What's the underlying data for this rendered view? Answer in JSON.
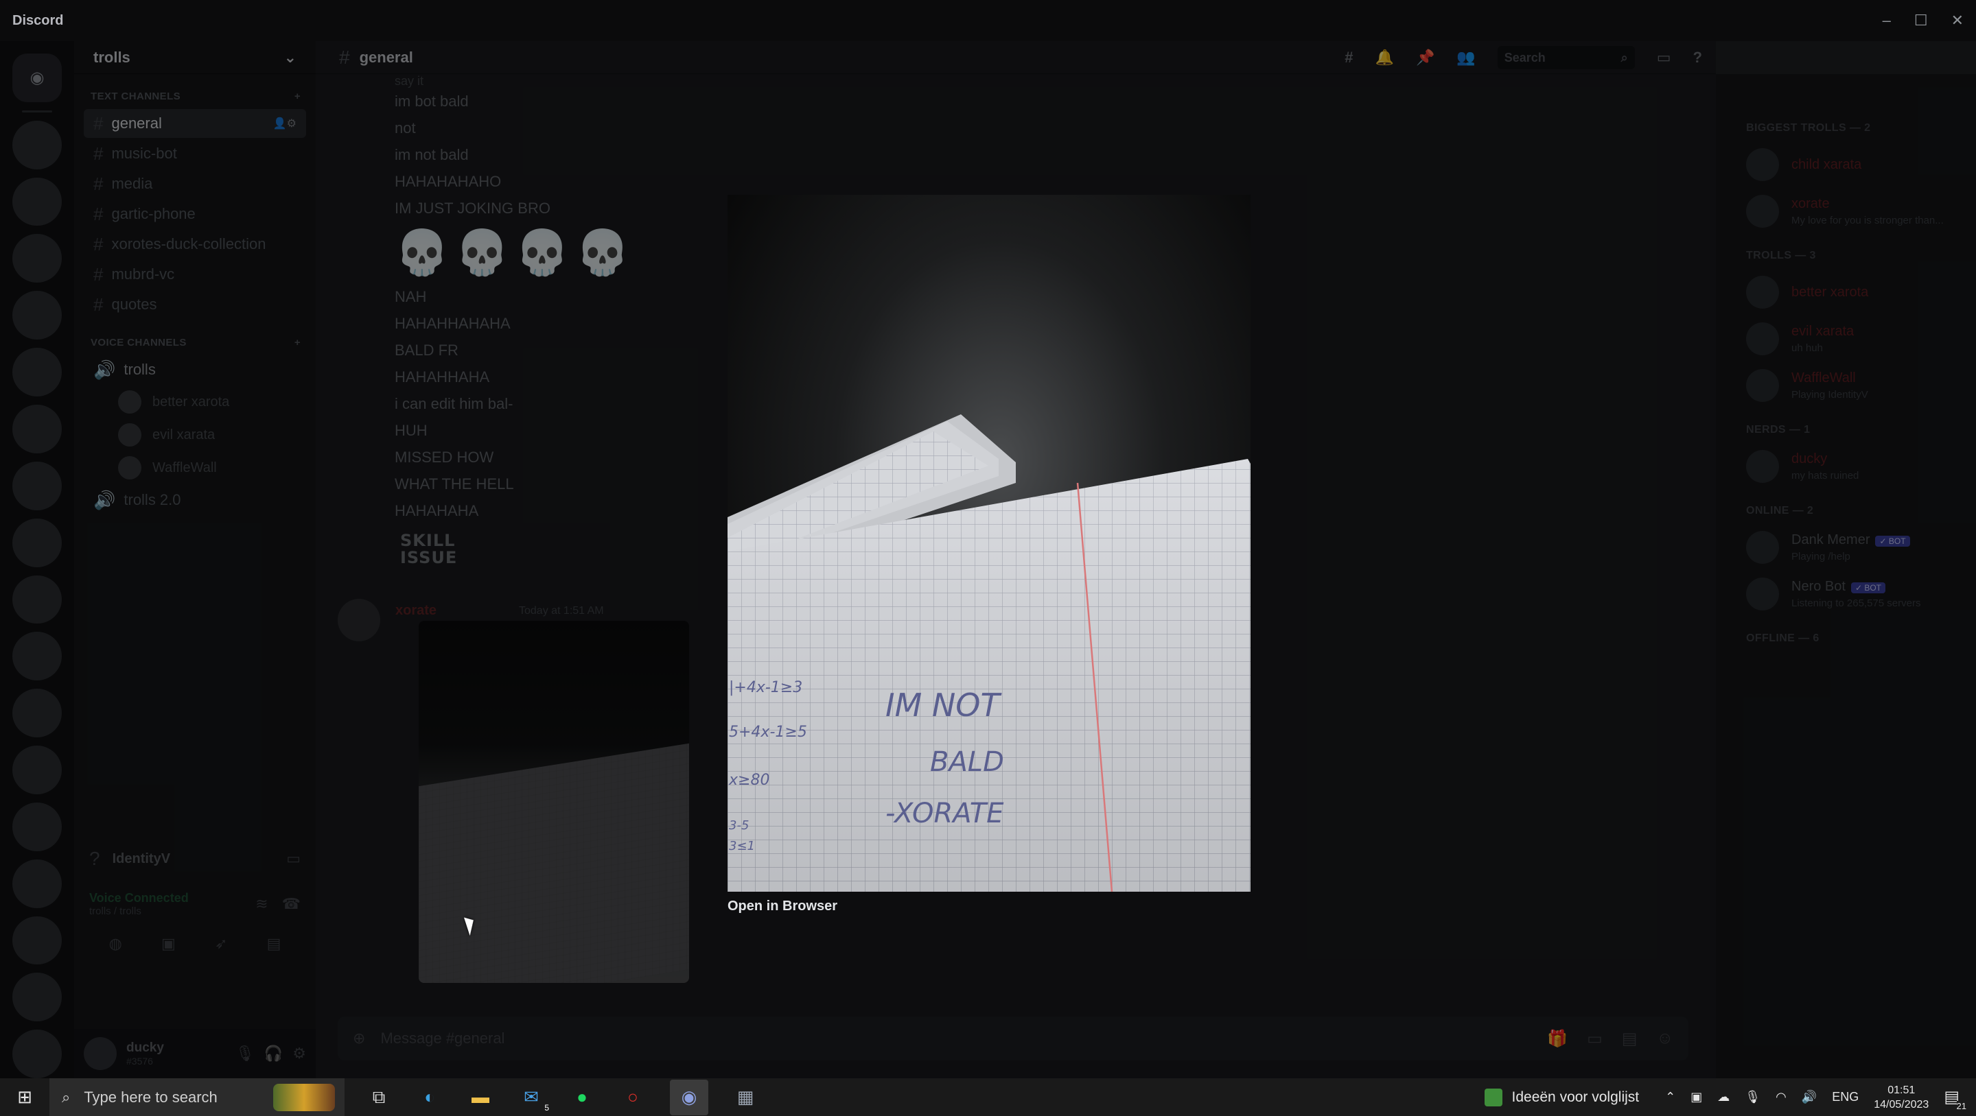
{
  "window": {
    "title": "Discord",
    "controls": [
      "–",
      "☐",
      "✕"
    ]
  },
  "server": {
    "name": "trolls"
  },
  "channels": {
    "text_category": "TEXT CHANNELS",
    "text": [
      {
        "name": "general",
        "active": true
      },
      {
        "name": "music-bot"
      },
      {
        "name": "media"
      },
      {
        "name": "gartic-phone"
      },
      {
        "name": "xorotes-duck-collection"
      },
      {
        "name": "mubrd-vc"
      },
      {
        "name": "quotes"
      }
    ],
    "voice_category": "VOICE CHANNELS",
    "voice_channel": "trolls",
    "voice_users": [
      "better xarota",
      "evil xarata",
      "WaffleWall"
    ],
    "voice_channel_2": "trolls 2.0"
  },
  "status_panel": {
    "activity": "IdentityV",
    "voice_connected": "Voice Connected",
    "voice_location": "trolls / trolls"
  },
  "user": {
    "name": "ducky",
    "tag": "#3576"
  },
  "chat": {
    "channel": "general",
    "search_placeholder": "Search",
    "messages": [
      "im bot bald",
      "not",
      "im not bald",
      "HAHAHAHAHO",
      "IM JUST JOKING BRO",
      "NAH",
      "HAHAHHAHAHA",
      "BALD FR",
      "HAHAHHAHA",
      "i can edit him bal-",
      "HUH",
      "MISSED HOW",
      "WHAT THE HELL",
      "HAHAHAHA"
    ],
    "first_line": "say it",
    "skull_count": 4,
    "sticker": {
      "line1": "SKILL",
      "line2": "ISSUE"
    },
    "second_message": {
      "author": "xorate",
      "time": "Today at 1:51 AM"
    },
    "composer_placeholder": "Message #general"
  },
  "members": {
    "groups": [
      {
        "label": "BIGGEST TROLLS — 2",
        "items": [
          {
            "name": "child xarata",
            "sub": "",
            "red": true
          },
          {
            "name": "xorate",
            "sub": "My love for you is stronger than...",
            "red": true
          }
        ]
      },
      {
        "label": "TROLLS — 3",
        "items": [
          {
            "name": "better xarota",
            "sub": "",
            "red": true
          },
          {
            "name": "evil xarata",
            "sub": "uh huh",
            "red": true
          },
          {
            "name": "WaffleWall",
            "sub": "Playing IdentityV",
            "red": true
          }
        ]
      },
      {
        "label": "NERDS — 1",
        "items": [
          {
            "name": "ducky",
            "sub": "my hats ruined",
            "red": true
          }
        ]
      },
      {
        "label": "ONLINE — 2",
        "items": [
          {
            "name": "Dank Memer",
            "sub": "Playing /help",
            "bot": "✓ BOT"
          },
          {
            "name": "Nero Bot",
            "sub": "Listening to 265,575 servers",
            "bot": "✓ BOT"
          }
        ]
      },
      {
        "label": "OFFLINE — 6",
        "items": []
      }
    ]
  },
  "lightbox": {
    "link": "Open in Browser",
    "handwriting": [
      "IM NOT",
      "BALD",
      "-XORATE"
    ],
    "margin_notes": [
      "|+4x-1≥3",
      "5+4x-1≥5",
      "x≥80",
      "3-5",
      "3≤1"
    ]
  },
  "taskbar": {
    "search_placeholder": "Type here to search",
    "mail_badge": "5",
    "news": "Ideeën voor volglijst",
    "tray_lang": "ENG",
    "time": "01:51",
    "date": "14/05/2023",
    "notifications": "21"
  }
}
